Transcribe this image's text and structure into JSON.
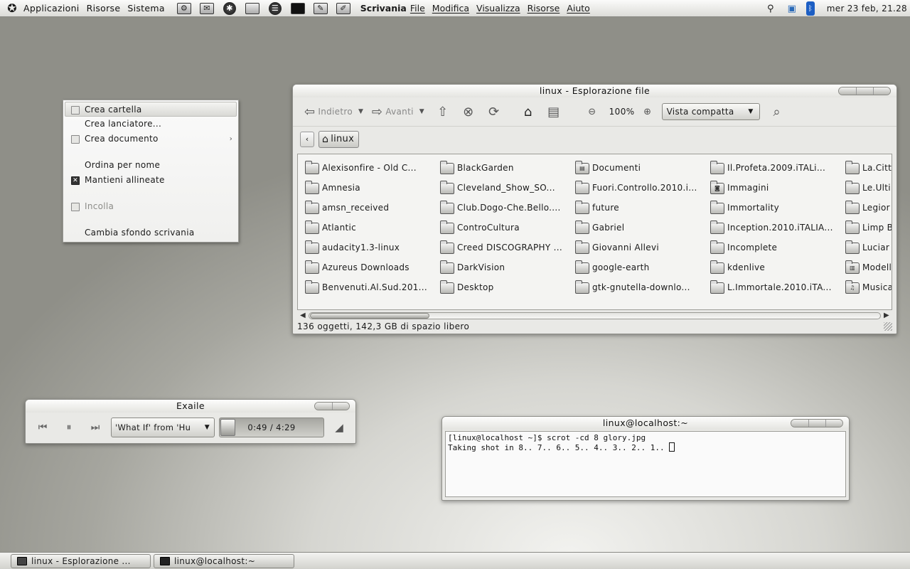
{
  "top_panel": {
    "menus": [
      "Applicazioni",
      "Risorse",
      "Sistema"
    ],
    "launchers": [
      {
        "icon": "mail-tool-icon",
        "glyph": "⚙"
      },
      {
        "icon": "mail-icon",
        "glyph": "✉"
      },
      {
        "icon": "browser-icon",
        "glyph": "✱"
      },
      {
        "icon": "folder-icon",
        "glyph": ""
      },
      {
        "icon": "messenger-icon",
        "glyph": "☰"
      },
      {
        "icon": "terminal-icon",
        "glyph": ""
      },
      {
        "icon": "gimp-icon",
        "glyph": "✎"
      },
      {
        "icon": "editor-icon",
        "glyph": "✐"
      }
    ],
    "active_app": "Scrivania",
    "app_menus": [
      "File",
      "Modifica",
      "Visualizza",
      "Risorse",
      "Aiuto"
    ],
    "clock": "mer 23 feb, 21.28"
  },
  "context_menu": {
    "items": [
      {
        "label": "Crea cartella",
        "icon": "folder-small-icon",
        "hover": true
      },
      {
        "label": "Crea lanciatore...",
        "icon": ""
      },
      {
        "label": "Crea documento",
        "icon": "document-small-icon",
        "submenu": true
      },
      {
        "separator": true
      },
      {
        "label": "Ordina per nome",
        "icon": ""
      },
      {
        "label": "Mantieni allineate",
        "icon": "checkbox-checked-icon",
        "checked": true
      },
      {
        "separator": true
      },
      {
        "label": "Incolla",
        "icon": "paste-icon",
        "disabled": true
      },
      {
        "separator": true
      },
      {
        "label": "Cambia sfondo scrivania",
        "icon": ""
      }
    ]
  },
  "file_manager": {
    "title": "linux - Esplorazione file",
    "back_label": "Indietro",
    "forward_label": "Avanti",
    "zoom": "100%",
    "view_mode": "Vista compatta",
    "location": "linux",
    "status": "136 oggetti, 142,3 GB di spazio libero",
    "columns": [
      [
        "Alexisonfire - Old C...",
        "Amnesia",
        "amsn_received",
        "Atlantic",
        "audacity1.3-linux",
        "Azureus Downloads",
        "Benvenuti.Al.Sud.201..."
      ],
      [
        "BlackGarden",
        "Cleveland_Show_SO...",
        "Club.Dogo-Che.Bello....",
        "ControCultura",
        "Creed DISCOGRAPHY ...",
        "DarkVision",
        "Desktop"
      ],
      [
        "Documenti",
        "Fuori.Controllo.2010.i...",
        "future",
        "Gabriel",
        "Giovanni Allevi",
        "google-earth",
        "gtk-gnutella-downlo..."
      ],
      [
        "Il.Profeta.2009.iTALi...",
        "Immagini",
        "Immortality",
        "Inception.2010.iTALIA...",
        "Incomplete",
        "kdenlive",
        "L.Immortale.2010.iTA..."
      ],
      [
        "La.Citt",
        "Le.Ulti",
        "Legior",
        "Limp B",
        "Luciar",
        "Modell",
        "Musica"
      ]
    ],
    "special_icons": {
      "Documenti": "▤",
      "Immagini": "◙",
      "Modell": "▥",
      "Musica": "♫"
    }
  },
  "exaile": {
    "title": "Exaile",
    "track": "'What If' from 'Hu",
    "time": "0:49 / 4:29",
    "progress": 0.18
  },
  "terminal": {
    "title": "linux@localhost:~",
    "lines": [
      "[linux@localhost ~]$ scrot -cd 8 glory.jpg",
      "Taking shot in 8.. 7.. 6.. 5.. 4.. 3.. 2.. 1.. "
    ]
  },
  "taskbar": {
    "tasks": [
      {
        "label": "linux - Esplorazione ...",
        "icon": "file-manager-icon"
      },
      {
        "label": "linux@localhost:~",
        "icon": "terminal-icon"
      }
    ]
  }
}
